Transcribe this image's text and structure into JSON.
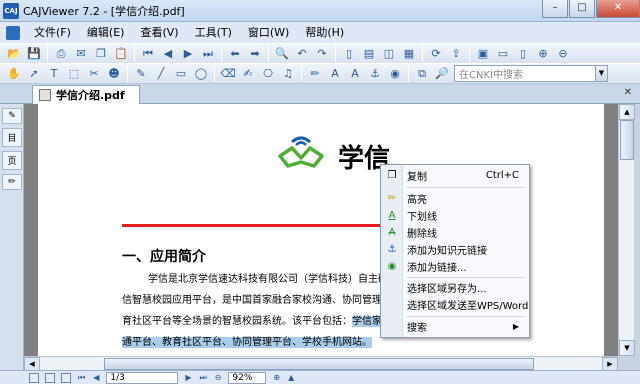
{
  "window": {
    "title": "CAJViewer 7.2 - [学信介绍.pdf]",
    "app_icon_text": "CAJ"
  },
  "window_buttons": {
    "minimize": "–",
    "maximize": "□",
    "close": "✕"
  },
  "menu": {
    "items": [
      "文件(F)",
      "编辑(E)",
      "查看(V)",
      "工具(T)",
      "窗口(W)",
      "帮助(H)"
    ]
  },
  "toolbar2": {
    "search_placeholder": "在CNKI中搜索"
  },
  "tab": {
    "label": "学信介绍.pdf"
  },
  "sidebar": {
    "tabs": [
      "目",
      "页"
    ]
  },
  "document": {
    "logo_text": "学信",
    "heading": "一、应用简介",
    "lines": [
      "学信是北京学信速达科技有限公司（学信科技）自主研",
      "信智慧校园应用平台，是中国首家融合家校沟通、协同管理",
      "育社区平台等全场景的智慧校园系统。该平台包括：",
      "通平台、教育社区平台、协同管理平台、学校手机网站。"
    ],
    "line3_highlight": "学信家"
  },
  "statusbar": {
    "page": "1/3",
    "zoom": "92%"
  },
  "context_menu": {
    "items": [
      {
        "label": "复制",
        "shortcut": "Ctrl+C",
        "icon": "copy-icon"
      },
      {
        "label": "高亮",
        "icon": "highlight-icon"
      },
      {
        "label": "下划线",
        "icon": "underline-icon"
      },
      {
        "label": "删除线",
        "icon": "strikethrough-icon"
      },
      {
        "label": "添加为知识元链接",
        "icon": "anchor-icon"
      },
      {
        "label": "添加为链接...",
        "icon": "globe-link-icon"
      },
      {
        "label": "选择区域另存为...",
        "icon": ""
      },
      {
        "label": "选择区域发送至WPS/Word",
        "icon": ""
      },
      {
        "label": "搜索",
        "icon": "",
        "submenu_arrow": "▶"
      }
    ]
  },
  "colors": {
    "accent": "#1f5fb0",
    "redline": "#e41e1e",
    "selection": "#a9cde8",
    "logo_green": "#4caf32",
    "logo_blue": "#1a5fb4"
  }
}
